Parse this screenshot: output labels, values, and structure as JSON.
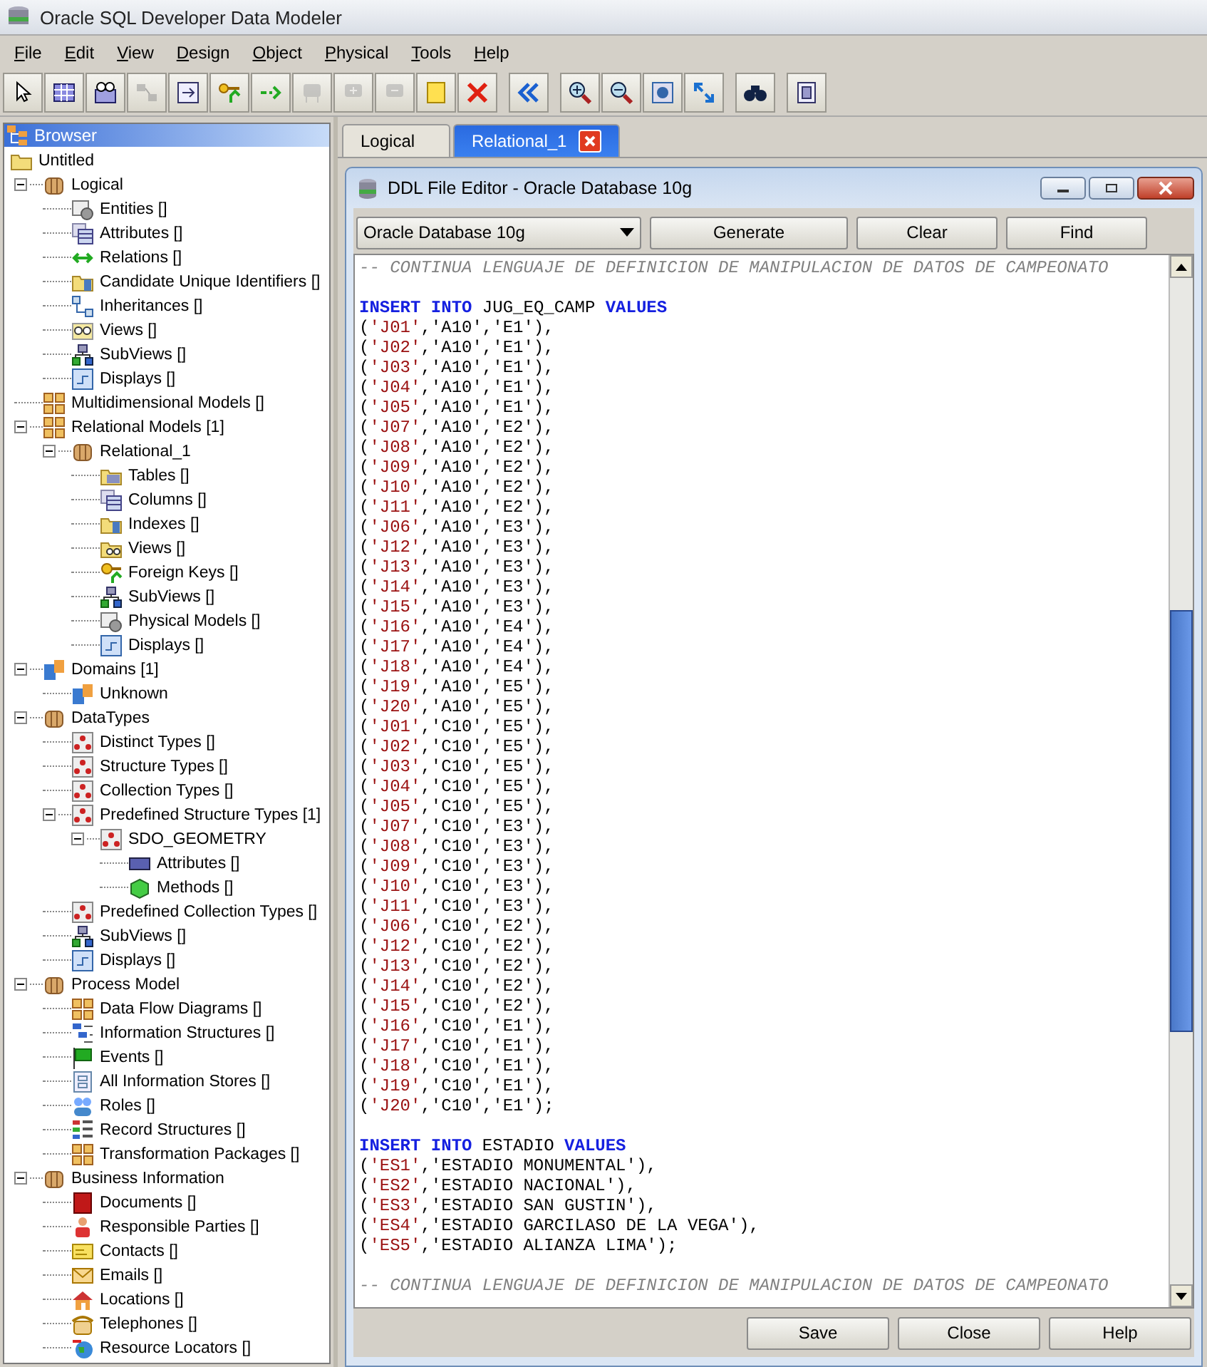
{
  "window": {
    "title": "Oracle SQL Developer Data Modeler"
  },
  "menu": [
    "File",
    "Edit",
    "View",
    "Design",
    "Object",
    "Physical",
    "Tools",
    "Help"
  ],
  "toolbar": [
    [
      {
        "kind": "pointer",
        "disabled": false
      },
      {
        "kind": "table",
        "disabled": false
      },
      {
        "kind": "view",
        "disabled": false
      },
      {
        "kind": "split",
        "disabled": true
      },
      {
        "kind": "merge",
        "disabled": false
      },
      {
        "kind": "key",
        "disabled": false
      },
      {
        "kind": "arrow",
        "disabled": false
      },
      {
        "kind": "box",
        "disabled": true
      },
      {
        "kind": "box-plus",
        "disabled": true
      },
      {
        "kind": "box-minus",
        "disabled": true
      },
      {
        "kind": "note",
        "disabled": false
      },
      {
        "kind": "delete",
        "disabled": false
      }
    ],
    [
      {
        "kind": "back",
        "disabled": false
      }
    ],
    [
      {
        "kind": "zoom-in",
        "disabled": false
      },
      {
        "kind": "zoom-out",
        "disabled": false
      },
      {
        "kind": "fit",
        "disabled": false
      },
      {
        "kind": "resize",
        "disabled": false
      }
    ],
    [
      {
        "kind": "binoculars",
        "disabled": false
      }
    ],
    [
      {
        "kind": "properties",
        "disabled": false
      }
    ]
  ],
  "browser": {
    "title": "Browser",
    "tree": {
      "label": "Untitled",
      "kind": "folder",
      "children": [
        {
          "label": "Logical",
          "kind": "model",
          "expanded": true,
          "children": [
            {
              "label": "Entities []",
              "kind": "entities"
            },
            {
              "label": "Attributes []",
              "kind": "attributes"
            },
            {
              "label": "Relations []",
              "kind": "relations"
            },
            {
              "label": "Candidate Unique Identifiers []",
              "kind": "folder-db"
            },
            {
              "label": "Inheritances []",
              "kind": "hierarchy"
            },
            {
              "label": "Views []",
              "kind": "glasses"
            },
            {
              "label": "SubViews []",
              "kind": "subviews"
            },
            {
              "label": "Displays []",
              "kind": "display"
            }
          ]
        },
        {
          "label": "Multidimensional Models []",
          "kind": "grid"
        },
        {
          "label": "Relational Models [1]",
          "kind": "grid",
          "expanded": true,
          "children": [
            {
              "label": "Relational_1",
              "kind": "model",
              "expanded": true,
              "children": [
                {
                  "label": "Tables []",
                  "kind": "folder-table"
                },
                {
                  "label": "Columns []",
                  "kind": "attributes"
                },
                {
                  "label": "Indexes []",
                  "kind": "folder-db"
                },
                {
                  "label": "Views []",
                  "kind": "folder-glasses"
                },
                {
                  "label": "Foreign Keys []",
                  "kind": "key"
                },
                {
                  "label": "SubViews []",
                  "kind": "subviews"
                },
                {
                  "label": "Physical Models []",
                  "kind": "entities"
                },
                {
                  "label": "Displays []",
                  "kind": "display"
                }
              ]
            }
          ]
        },
        {
          "label": "Domains [1]",
          "kind": "domain",
          "expanded": true,
          "children": [
            {
              "label": "Unknown",
              "kind": "domain"
            }
          ]
        },
        {
          "label": "DataTypes",
          "kind": "model",
          "expanded": true,
          "children": [
            {
              "label": "Distinct Types []",
              "kind": "type"
            },
            {
              "label": "Structure Types []",
              "kind": "type"
            },
            {
              "label": "Collection Types []",
              "kind": "type"
            },
            {
              "label": "Predefined Structure Types [1]",
              "kind": "type",
              "expanded": true,
              "children": [
                {
                  "label": "SDO_GEOMETRY",
                  "kind": "type",
                  "expanded": true,
                  "children": [
                    {
                      "label": "Attributes []",
                      "kind": "xyz"
                    },
                    {
                      "label": "Methods []",
                      "kind": "cube"
                    }
                  ]
                }
              ]
            },
            {
              "label": "Predefined Collection Types []",
              "kind": "type"
            },
            {
              "label": "SubViews []",
              "kind": "subviews"
            },
            {
              "label": "Displays []",
              "kind": "display"
            }
          ]
        },
        {
          "label": "Process Model",
          "kind": "model",
          "expanded": true,
          "children": [
            {
              "label": "Data Flow Diagrams []",
              "kind": "grid"
            },
            {
              "label": "Information Structures []",
              "kind": "structure"
            },
            {
              "label": "Events []",
              "kind": "flag"
            },
            {
              "label": "All Information Stores []",
              "kind": "store"
            },
            {
              "label": "Roles []",
              "kind": "people"
            },
            {
              "label": "Record Structures []",
              "kind": "record"
            },
            {
              "label": "Transformation Packages []",
              "kind": "grid"
            }
          ]
        },
        {
          "label": "Business Information",
          "kind": "model",
          "expanded": true,
          "children": [
            {
              "label": "Documents []",
              "kind": "book"
            },
            {
              "label": "Responsible Parties []",
              "kind": "person"
            },
            {
              "label": "Contacts []",
              "kind": "card"
            },
            {
              "label": "Emails []",
              "kind": "envelope"
            },
            {
              "label": "Locations []",
              "kind": "house"
            },
            {
              "label": "Telephones []",
              "kind": "phone"
            },
            {
              "label": "Resource Locators []",
              "kind": "globe"
            }
          ]
        }
      ]
    }
  },
  "tabs": [
    {
      "label": "Logical",
      "selected": false,
      "closable": false
    },
    {
      "label": "Relational_1",
      "selected": true,
      "closable": true
    }
  ],
  "editor": {
    "title": "DDL File Editor - Oracle Database 10g",
    "database": "Oracle Database 10g",
    "buttons": [
      "Generate",
      "Clear",
      "Find"
    ],
    "lines": [
      {
        "kind": "comment",
        "text": "-- CONTINUA LENGUAJE DE DEFINICION DE MANIPULACION DE DATOS DE CAMPEONATO"
      },
      {
        "kind": "blank"
      },
      {
        "kind": "insert",
        "keywords": [
          "INSERT",
          "INTO",
          "VALUES"
        ],
        "table": "JUG_EQ_CAMP"
      },
      {
        "kind": "row",
        "open": "(",
        "key": "'J01'",
        "rest": ",'A10','E1'),"
      },
      {
        "kind": "row",
        "open": "(",
        "key": "'J02'",
        "rest": ",'A10','E1'),"
      },
      {
        "kind": "row",
        "open": "(",
        "key": "'J03'",
        "rest": ",'A10','E1'),"
      },
      {
        "kind": "row",
        "open": "(",
        "key": "'J04'",
        "rest": ",'A10','E1'),"
      },
      {
        "kind": "row",
        "open": "(",
        "key": "'J05'",
        "rest": ",'A10','E1'),"
      },
      {
        "kind": "row",
        "open": "(",
        "key": "'J07'",
        "rest": ",'A10','E2'),"
      },
      {
        "kind": "row",
        "open": "(",
        "key": "'J08'",
        "rest": ",'A10','E2'),"
      },
      {
        "kind": "row",
        "open": "(",
        "key": "'J09'",
        "rest": ",'A10','E2'),"
      },
      {
        "kind": "row",
        "open": "(",
        "key": "'J10'",
        "rest": ",'A10','E2'),"
      },
      {
        "kind": "row",
        "open": "(",
        "key": "'J11'",
        "rest": ",'A10','E2'),"
      },
      {
        "kind": "row",
        "open": "(",
        "key": "'J06'",
        "rest": ",'A10','E3'),"
      },
      {
        "kind": "row",
        "open": "(",
        "key": "'J12'",
        "rest": ",'A10','E3'),"
      },
      {
        "kind": "row",
        "open": "(",
        "key": "'J13'",
        "rest": ",'A10','E3'),"
      },
      {
        "kind": "row",
        "open": "(",
        "key": "'J14'",
        "rest": ",'A10','E3'),"
      },
      {
        "kind": "row",
        "open": "(",
        "key": "'J15'",
        "rest": ",'A10','E3'),"
      },
      {
        "kind": "row",
        "open": "(",
        "key": "'J16'",
        "rest": ",'A10','E4'),"
      },
      {
        "kind": "row",
        "open": "(",
        "key": "'J17'",
        "rest": ",'A10','E4'),"
      },
      {
        "kind": "row",
        "open": "(",
        "key": "'J18'",
        "rest": ",'A10','E4'),"
      },
      {
        "kind": "row",
        "open": "(",
        "key": "'J19'",
        "rest": ",'A10','E5'),"
      },
      {
        "kind": "row",
        "open": "(",
        "key": "'J20'",
        "rest": ",'A10','E5'),"
      },
      {
        "kind": "row",
        "open": "(",
        "key": "'J01'",
        "rest": ",'C10','E5'),"
      },
      {
        "kind": "row",
        "open": "(",
        "key": "'J02'",
        "rest": ",'C10','E5'),"
      },
      {
        "kind": "row",
        "open": "(",
        "key": "'J03'",
        "rest": ",'C10','E5'),"
      },
      {
        "kind": "row",
        "open": "(",
        "key": "'J04'",
        "rest": ",'C10','E5'),"
      },
      {
        "kind": "row",
        "open": "(",
        "key": "'J05'",
        "rest": ",'C10','E5'),"
      },
      {
        "kind": "row",
        "open": "(",
        "key": "'J07'",
        "rest": ",'C10','E3'),"
      },
      {
        "kind": "row",
        "open": "(",
        "key": "'J08'",
        "rest": ",'C10','E3'),"
      },
      {
        "kind": "row",
        "open": "(",
        "key": "'J09'",
        "rest": ",'C10','E3'),"
      },
      {
        "kind": "row",
        "open": "(",
        "key": "'J10'",
        "rest": ",'C10','E3'),"
      },
      {
        "kind": "row",
        "open": "(",
        "key": "'J11'",
        "rest": ",'C10','E3'),"
      },
      {
        "kind": "row",
        "open": "(",
        "key": "'J06'",
        "rest": ",'C10','E2'),"
      },
      {
        "kind": "row",
        "open": "(",
        "key": "'J12'",
        "rest": ",'C10','E2'),"
      },
      {
        "kind": "row",
        "open": "(",
        "key": "'J13'",
        "rest": ",'C10','E2'),"
      },
      {
        "kind": "row",
        "open": "(",
        "key": "'J14'",
        "rest": ",'C10','E2'),"
      },
      {
        "kind": "row",
        "open": "(",
        "key": "'J15'",
        "rest": ",'C10','E2'),"
      },
      {
        "kind": "row",
        "open": "(",
        "key": "'J16'",
        "rest": ",'C10','E1'),"
      },
      {
        "kind": "row",
        "open": "(",
        "key": "'J17'",
        "rest": ",'C10','E1'),"
      },
      {
        "kind": "row",
        "open": "(",
        "key": "'J18'",
        "rest": ",'C10','E1'),"
      },
      {
        "kind": "row",
        "open": "(",
        "key": "'J19'",
        "rest": ",'C10','E1'),"
      },
      {
        "kind": "row",
        "open": "(",
        "key": "'J20'",
        "rest": ",'C10','E1');"
      },
      {
        "kind": "blank"
      },
      {
        "kind": "insert",
        "keywords": [
          "INSERT",
          "INTO",
          "VALUES"
        ],
        "table": "ESTADIO"
      },
      {
        "kind": "row",
        "open": "(",
        "key": "'ES1'",
        "rest": ",'ESTADIO MONUMENTAL'),"
      },
      {
        "kind": "row",
        "open": "(",
        "key": "'ES2'",
        "rest": ",'ESTADIO NACIONAL'),"
      },
      {
        "kind": "row",
        "open": "(",
        "key": "'ES3'",
        "rest": ",'ESTADIO SAN GUSTIN'),"
      },
      {
        "kind": "row",
        "open": "(",
        "key": "'ES4'",
        "rest": ",'ESTADIO GARCILASO DE LA VEGA'),"
      },
      {
        "kind": "row",
        "open": "(",
        "key": "'ES5'",
        "rest": ",'ESTADIO ALIANZA LIMA');"
      },
      {
        "kind": "blank"
      },
      {
        "kind": "comment",
        "text": "-- CONTINUA LENGUAJE DE DEFINICION DE MANIPULACION DE DATOS DE CAMPEONATO"
      }
    ],
    "footer_buttons": [
      "Save",
      "Close",
      "Help"
    ]
  }
}
